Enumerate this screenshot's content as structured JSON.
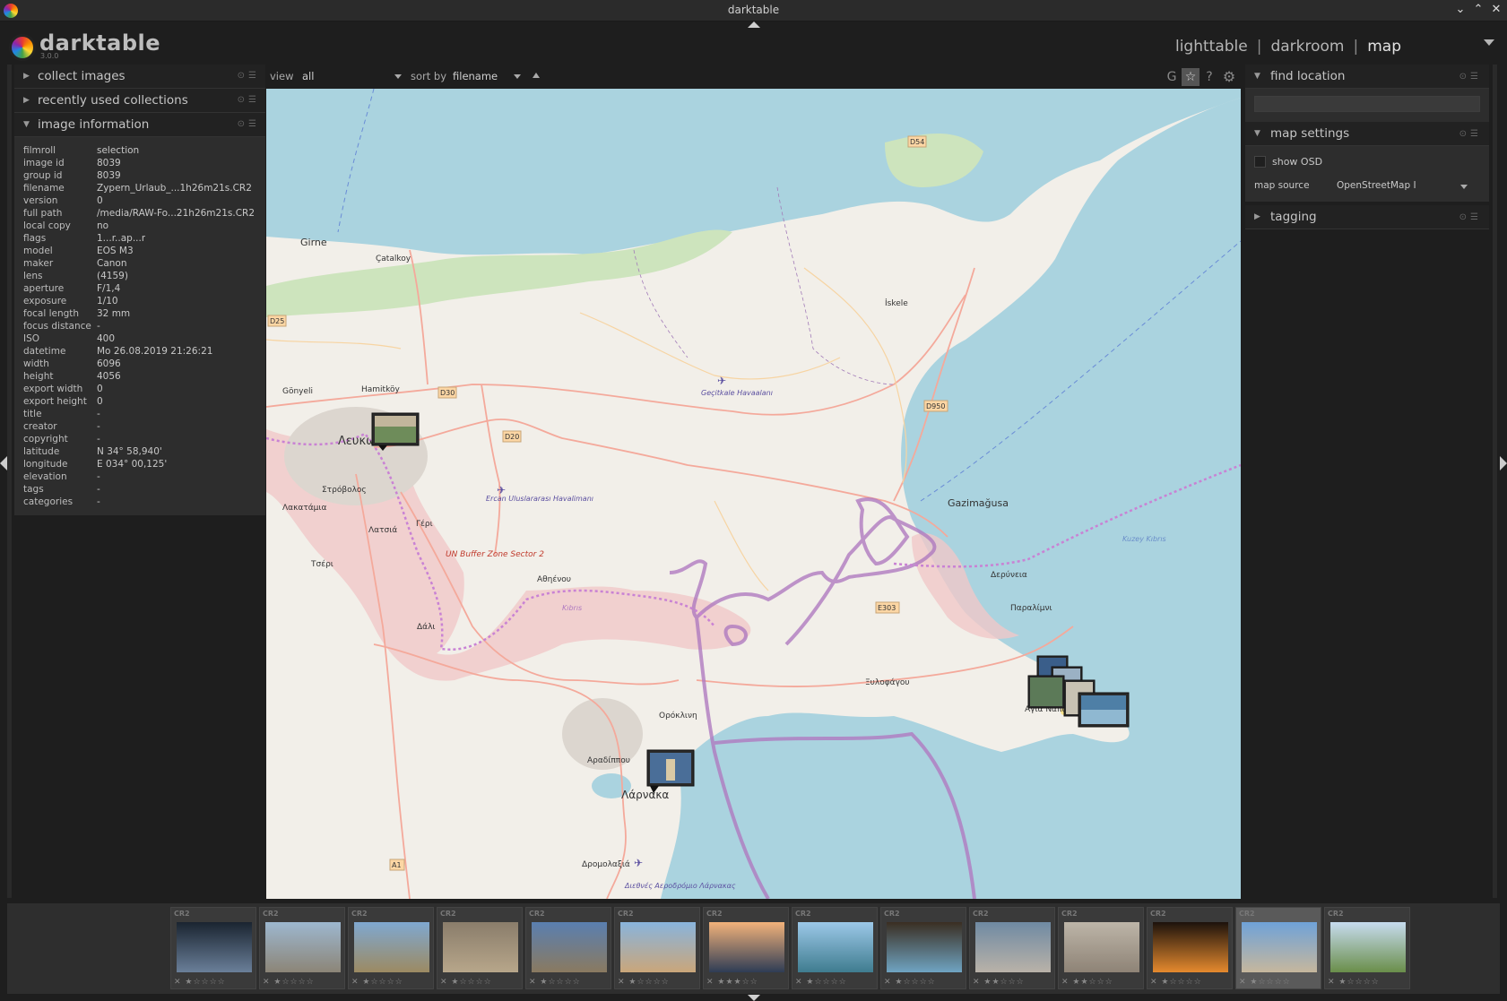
{
  "window": {
    "title": "darktable",
    "app_icon": "darktable-logo-icon"
  },
  "header": {
    "brand": "darktable",
    "version": "3.0.0",
    "views": [
      {
        "label": "lighttable",
        "active": false
      },
      {
        "label": "darkroom",
        "active": false
      },
      {
        "label": "map",
        "active": true
      }
    ],
    "separator": "|"
  },
  "left_panel": {
    "sections": [
      {
        "label": "collect images",
        "expanded": false
      },
      {
        "label": "recently used collections",
        "expanded": false
      },
      {
        "label": "image information",
        "expanded": true
      }
    ],
    "image_information": [
      {
        "key": "filmroll",
        "value": "selection"
      },
      {
        "key": "image id",
        "value": "8039"
      },
      {
        "key": "group id",
        "value": "8039"
      },
      {
        "key": "filename",
        "value": "Zypern_Urlaub_...1h26m21s.CR2"
      },
      {
        "key": "version",
        "value": "0"
      },
      {
        "key": "full path",
        "value": "/media/RAW-Fo...21h26m21s.CR2"
      },
      {
        "key": "local copy",
        "value": "no"
      },
      {
        "key": "flags",
        "value": "1...r..ap...r"
      },
      {
        "key": "model",
        "value": "EOS M3"
      },
      {
        "key": "maker",
        "value": "Canon"
      },
      {
        "key": "lens",
        "value": "(4159)"
      },
      {
        "key": "aperture",
        "value": "F/1,4"
      },
      {
        "key": "exposure",
        "value": "1/10"
      },
      {
        "key": "focal length",
        "value": "32 mm"
      },
      {
        "key": "focus distance",
        "value": "-"
      },
      {
        "key": "ISO",
        "value": "400"
      },
      {
        "key": "datetime",
        "value": "Mo 26.08.2019 21:26:21"
      },
      {
        "key": "width",
        "value": "6096"
      },
      {
        "key": "height",
        "value": "4056"
      },
      {
        "key": "export width",
        "value": "0"
      },
      {
        "key": "export height",
        "value": "0"
      },
      {
        "key": "title",
        "value": "-"
      },
      {
        "key": "creator",
        "value": "-"
      },
      {
        "key": "copyright",
        "value": "-"
      },
      {
        "key": "latitude",
        "value": "N 34° 58,940'"
      },
      {
        "key": "longitude",
        "value": "E 034° 00,125'"
      },
      {
        "key": "elevation",
        "value": "-"
      },
      {
        "key": "tags",
        "value": "-"
      },
      {
        "key": "categories",
        "value": "-"
      }
    ]
  },
  "center_toolbar": {
    "view_label": "view",
    "view_value": "all",
    "sort_label": "sort by",
    "sort_value": "filename",
    "grouping_icon": "G",
    "star_icon": "☆",
    "help_icon": "?",
    "prefs_icon": "⚙"
  },
  "map": {
    "labels": {
      "girne": "Girne",
      "catalkoy": "Çatalkoy",
      "iskele": "İskele",
      "gonyeli": "Gönyeli",
      "hamitkoy": "Hamitköy",
      "lefkosia": "Λευκωσία",
      "strovolos": "Στρόβολος",
      "lakatamia": "Λακατάμια",
      "latsia": "Λατσιά",
      "geri": "Γέρι",
      "tseri": "Τσέρι",
      "dali": "Δάλι",
      "athienou": "Αθηένου",
      "gazimagusa": "Gazimağusa",
      "derynia": "Δερύνεια",
      "paralimni": "Παραλίμνι",
      "agia_napa": "Αγια Νάπα",
      "xylofagou": "Ξυλοφάγου",
      "oroklini": "Ορόκλινη",
      "aradippou": "Αραδίππου",
      "larnaka": "Λάρνακα",
      "dromolaxia": "Δρομολαξιά",
      "un_zone": "UN Buffer Zone Sector 2",
      "gecitkale": "Geçitkale Havaalanı",
      "ercan": "Ercan Uluslararası Havalimanı",
      "larnaca_airport": "Διεθνές Αεροδρόμιο Λάρνακας",
      "kuzey_kibris": "Kuzey Kıbrıs",
      "kibris": "Kıbrıs",
      "road_d54": "D54",
      "road_d25": "D25",
      "road_d30": "D30",
      "road_d20": "D20",
      "road_d950": "D950",
      "road_e303": "E303",
      "road_a1": "A1"
    },
    "colors": {
      "sea": "#aad3df",
      "land": "#f2efe9",
      "forest": "#cde4bd",
      "border": "#b07bc0",
      "zone": "#f0c8c8"
    }
  },
  "right_panel": {
    "find_location": {
      "label": "find location",
      "value": ""
    },
    "map_settings": {
      "label": "map settings",
      "show_osd_label": "show OSD",
      "show_osd": false,
      "map_source_label": "map source",
      "map_source_value": "OpenStreetMap I"
    },
    "tagging": {
      "label": "tagging"
    }
  },
  "filmstrip": {
    "thumbs": [
      {
        "ext": "CR2",
        "stars": 1,
        "colors": [
          "#1a2430",
          "#6a7f99"
        ]
      },
      {
        "ext": "CR2",
        "stars": 1,
        "colors": [
          "#9db7cf",
          "#8c8577"
        ]
      },
      {
        "ext": "CR2",
        "stars": 1,
        "colors": [
          "#7fa8d0",
          "#9c8a62"
        ]
      },
      {
        "ext": "CR2",
        "stars": 1,
        "colors": [
          "#8a7d6b",
          "#b7a68a"
        ]
      },
      {
        "ext": "CR2",
        "stars": 1,
        "colors": [
          "#5a7fb0",
          "#8a7a60"
        ]
      },
      {
        "ext": "CR2",
        "stars": 1,
        "colors": [
          "#89b4dc",
          "#caa67a"
        ]
      },
      {
        "ext": "CR2",
        "stars": 3,
        "colors": [
          "#f2b27a",
          "#2e3c55"
        ]
      },
      {
        "ext": "CR2",
        "stars": 1,
        "colors": [
          "#9cc8e8",
          "#3f7c8f"
        ]
      },
      {
        "ext": "CR2",
        "stars": 1,
        "colors": [
          "#3a2e22",
          "#6fa4c2"
        ]
      },
      {
        "ext": "CR2",
        "stars": 2,
        "colors": [
          "#6f8aa3",
          "#b9b2a8"
        ]
      },
      {
        "ext": "CR2",
        "stars": 2,
        "colors": [
          "#bdb5a8",
          "#8e8376"
        ]
      },
      {
        "ext": "CR2",
        "stars": 1,
        "colors": [
          "#1c120c",
          "#e58a2e"
        ]
      },
      {
        "ext": "CR2",
        "stars": 1,
        "colors": [
          "#6fa2d8",
          "#c6b79d"
        ]
      },
      {
        "ext": "CR2",
        "stars": 1,
        "colors": [
          "#c7dcef",
          "#6a8e4a"
        ]
      }
    ]
  }
}
